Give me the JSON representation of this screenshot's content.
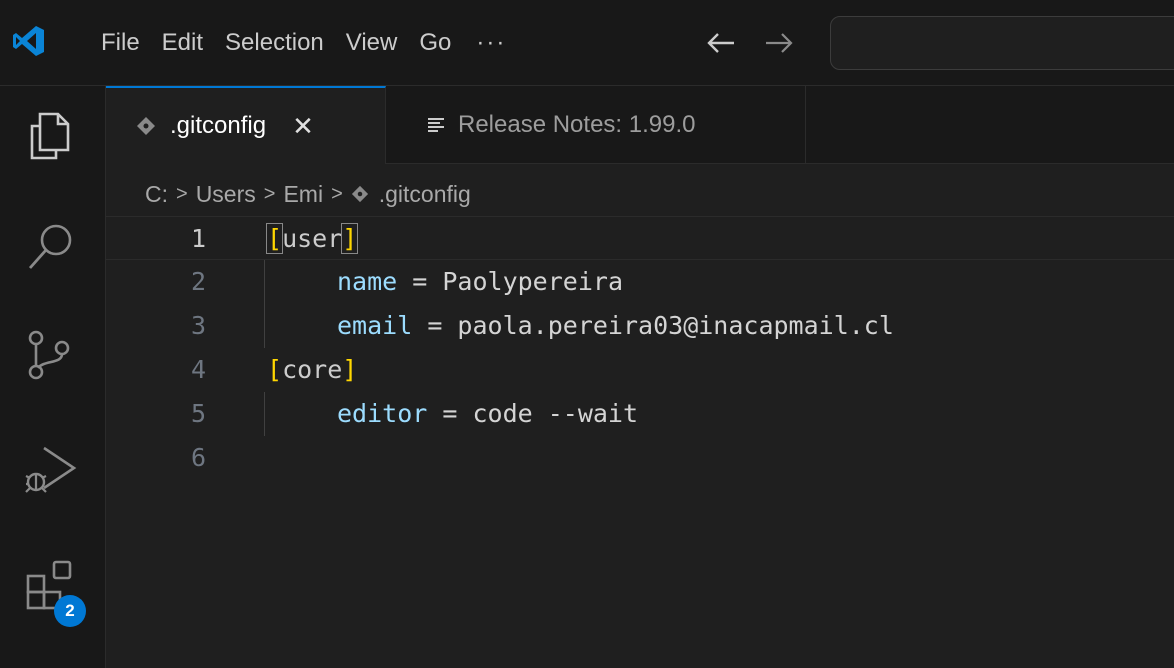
{
  "menu": {
    "items": [
      "File",
      "Edit",
      "Selection",
      "View",
      "Go"
    ],
    "more": "···"
  },
  "activity": {
    "extensions_badge": "2"
  },
  "tabs": [
    {
      "label": ".gitconfig",
      "close": "✕"
    },
    {
      "label": "Release Notes: 1.99.0"
    }
  ],
  "breadcrumb": {
    "items": [
      "C:",
      "Users",
      "Emi",
      ".gitconfig"
    ]
  },
  "editor": {
    "lines": [
      {
        "num": "1",
        "section": "user"
      },
      {
        "num": "2",
        "key": "name",
        "eq": " = ",
        "value": "Paolypereira"
      },
      {
        "num": "3",
        "key": "email",
        "eq": " = ",
        "value": "paola.pereira03@inacapmail.cl"
      },
      {
        "num": "4",
        "section": "core"
      },
      {
        "num": "5",
        "key": "editor",
        "eq": " = ",
        "value": "code --wait"
      },
      {
        "num": "6"
      }
    ]
  },
  "colors": {
    "accent": "#0078d4",
    "key": "#9cdcfe",
    "bracket": "#ffd700"
  }
}
